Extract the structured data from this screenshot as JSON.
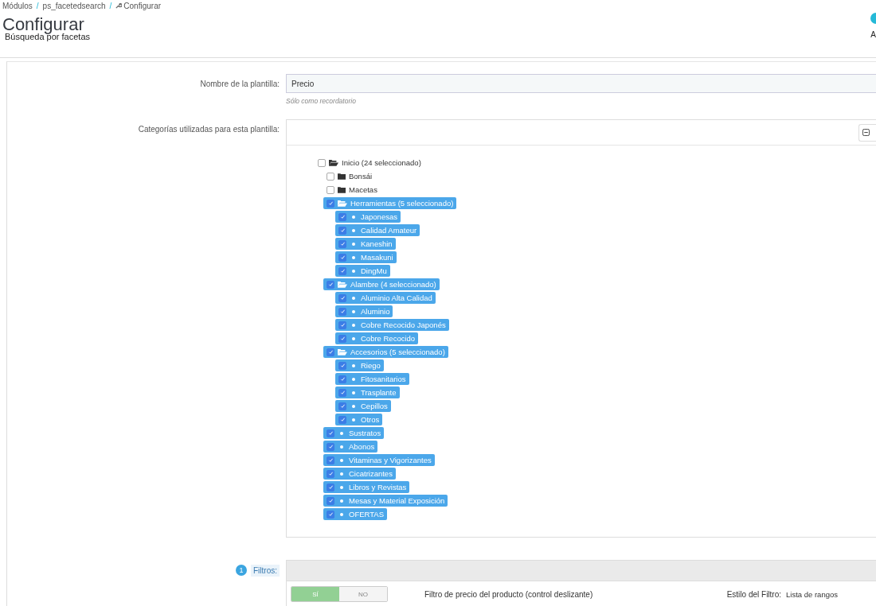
{
  "breadcrumb": [
    "Módulos",
    "ps_facetedsearch",
    "Configurar"
  ],
  "breadcrumb_separator": "/",
  "page_title": "Configurar",
  "page_subtitle": "Búsqueda por facetas",
  "toolbar_button": {
    "label": "A"
  },
  "template_name": {
    "label": "Nombre de la plantilla:",
    "value": "Precio",
    "help": "Sólo como recordatorio"
  },
  "categories": {
    "label": "Categorías utilizadas para esta plantilla:",
    "tree": [
      {
        "label": "Inicio (24 seleccionado)",
        "kind": "folder",
        "checked": false,
        "expanded": true,
        "children": [
          {
            "label": "Bonsái",
            "kind": "folder",
            "checked": false,
            "expanded": false
          },
          {
            "label": "Macetas",
            "kind": "folder",
            "checked": false,
            "expanded": false
          },
          {
            "label": "Herramientas (5 seleccionado)",
            "kind": "folder",
            "checked": true,
            "expanded": true,
            "children": [
              {
                "label": "Japonesas",
                "kind": "leaf",
                "checked": true
              },
              {
                "label": "Calidad Amateur",
                "kind": "leaf",
                "checked": true
              },
              {
                "label": "Kaneshin",
                "kind": "leaf",
                "checked": true
              },
              {
                "label": "Masakuni",
                "kind": "leaf",
                "checked": true
              },
              {
                "label": "DingMu",
                "kind": "leaf",
                "checked": true
              }
            ]
          },
          {
            "label": "Alambre (4 seleccionado)",
            "kind": "folder",
            "checked": true,
            "expanded": true,
            "children": [
              {
                "label": "Aluminio Alta Calidad",
                "kind": "leaf",
                "checked": true
              },
              {
                "label": "Aluminio",
                "kind": "leaf",
                "checked": true
              },
              {
                "label": "Cobre Recocido Japonés",
                "kind": "leaf",
                "checked": true
              },
              {
                "label": "Cobre Recocido",
                "kind": "leaf",
                "checked": true
              }
            ]
          },
          {
            "label": "Accesorios (5 seleccionado)",
            "kind": "folder",
            "checked": true,
            "expanded": true,
            "children": [
              {
                "label": "Riego",
                "kind": "leaf",
                "checked": true
              },
              {
                "label": "Fitosanitarios",
                "kind": "leaf",
                "checked": true
              },
              {
                "label": "Trasplante",
                "kind": "leaf",
                "checked": true
              },
              {
                "label": "Cepillos",
                "kind": "leaf",
                "checked": true
              },
              {
                "label": "Otros",
                "kind": "leaf",
                "checked": true
              }
            ]
          },
          {
            "label": "Sustratos",
            "kind": "leaf",
            "checked": true
          },
          {
            "label": "Abonos",
            "kind": "leaf",
            "checked": true
          },
          {
            "label": "Vitaminas y Vigorizantes",
            "kind": "leaf",
            "checked": true
          },
          {
            "label": "Cicatrizantes",
            "kind": "leaf",
            "checked": true
          },
          {
            "label": "Libros y Revistas",
            "kind": "leaf",
            "checked": true
          },
          {
            "label": "Mesas y Material Exposición",
            "kind": "leaf",
            "checked": true
          },
          {
            "label": "OFERTAS",
            "kind": "leaf",
            "checked": true
          }
        ]
      }
    ]
  },
  "filters": {
    "badge": "1",
    "label": "Filtros:",
    "rows": [
      {
        "toggle_on": "SÍ",
        "toggle_off": "NO",
        "enabled": true,
        "name": "Filtro de precio del producto (control deslizante)",
        "style_label": "Estilo del Filtro:",
        "style_value": "Lista de rangos"
      }
    ]
  }
}
